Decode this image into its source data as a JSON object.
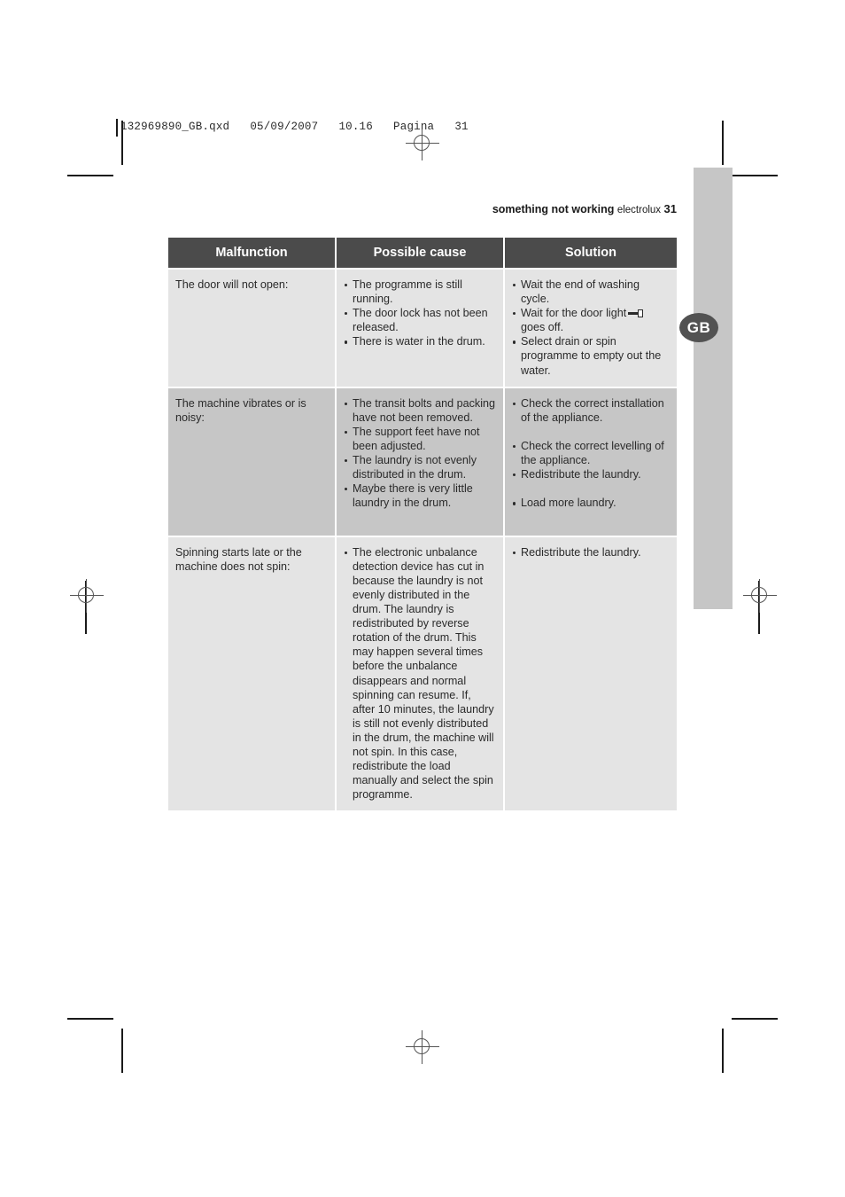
{
  "file_header": {
    "text": "132969890_GB.qxd   05/09/2007   10.16   Pagina   31"
  },
  "side_tab": {
    "language_badge": "GB"
  },
  "running_head": {
    "section": "something not working",
    "brand": "electrolux",
    "page_number": "31"
  },
  "colors": {
    "header_row_bg": "#4b4b4b",
    "header_row_text": "#ffffff",
    "row_light_bg": "#e4e4e4",
    "row_dark_bg": "#c6c6c6",
    "side_tab_bg": "#c6c6c6",
    "badge_bg": "#525252",
    "body_text": "#2a2a2a"
  },
  "table": {
    "headers": [
      "Malfunction",
      "Possible cause",
      "Solution"
    ],
    "rows": [
      {
        "shade": "light",
        "malfunction": "The door will not open:",
        "possible_cause": [
          "The programme is still running.",
          "The door lock has not been released.",
          "There is water in the drum."
        ],
        "solution": [
          {
            "text": "Wait the end of washing cycle."
          },
          {
            "text_before_icon": "Wait for the door light",
            "icon": "door-lock-icon",
            "text_after_icon": "goes off."
          },
          {
            "text": "Select drain or spin programme to empty out the water."
          }
        ]
      },
      {
        "shade": "dark",
        "malfunction": "The machine vibrates or is noisy:",
        "possible_cause": [
          "The transit bolts and packing have not been removed.",
          "The support feet have not been adjusted.",
          "The laundry is not evenly distributed in the drum.",
          "Maybe there is very little laundry in the drum."
        ],
        "solution": [
          {
            "text": "Check the correct installation of the appliance.",
            "gap_above": false
          },
          {
            "text": "Check the correct levelling of the appliance.",
            "gap_above": true
          },
          {
            "text": "Redistribute the laundry.",
            "gap_above": false
          },
          {
            "text": "Load more laundry.",
            "gap_above": true
          }
        ]
      },
      {
        "shade": "light",
        "malfunction": "Spinning starts late or the machine does not spin:",
        "possible_cause": [
          "The electronic unbalance detection device has cut in because the laundry is not evenly distributed  in the drum. The laundry is redistributed by reverse rotation of the drum. This may happen several times before the unbalance disappears and normal spinning can resume. If, after 10 minutes, the laundry is still not evenly distributed in the drum, the machine will not spin. In this case, redistribute the load manually and select the spin programme."
        ],
        "solution": [
          {
            "text": "Redistribute the laundry."
          }
        ]
      }
    ]
  }
}
